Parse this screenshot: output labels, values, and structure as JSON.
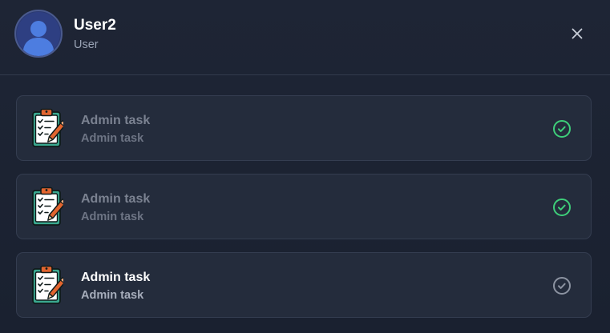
{
  "user": {
    "name": "User2",
    "role": "User"
  },
  "header": {
    "close_icon": "close-icon",
    "avatar_icon": "user-avatar-icon"
  },
  "tasks": [
    {
      "title": "Admin task",
      "subtitle": "Admin task",
      "status": "completed",
      "icon": "clipboard-checklist-icon"
    },
    {
      "title": "Admin task",
      "subtitle": "Admin task",
      "status": "completed",
      "icon": "clipboard-checklist-icon"
    },
    {
      "title": "Admin task",
      "subtitle": "Admin task",
      "status": "pending",
      "icon": "clipboard-checklist-icon"
    }
  ],
  "colors": {
    "background": "#1c2333",
    "card": "#242c3c",
    "completed_check": "#3ecf7a",
    "pending_check": "#8c93a1",
    "avatar": "#2b3a73"
  }
}
